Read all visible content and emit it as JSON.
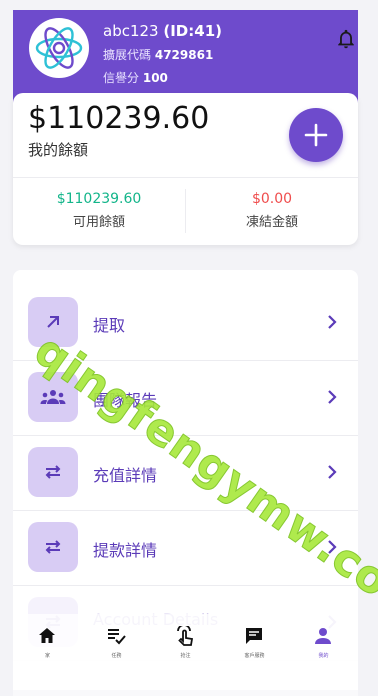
{
  "header": {
    "username": "abc123",
    "user_id": "(ID:41)",
    "promo_label": "擴展代碼",
    "promo_code": "4729861",
    "credit_label": "信譽分",
    "credit_value": "100",
    "accent": "#6e4bcc"
  },
  "balance_card": {
    "amount": "$110239.60",
    "label": "我的餘額",
    "available_value": "$110239.60",
    "available_label": "可用餘額",
    "frozen_value": "$0.00",
    "frozen_label": "凍結金額",
    "available_color": "#13b58a",
    "frozen_color": "#ef4d4d"
  },
  "menu": {
    "items": [
      {
        "label": "提取",
        "icon": "arrow-up-right-icon"
      },
      {
        "label": "團隊報告",
        "icon": "group-icon"
      },
      {
        "label": "充值詳情",
        "icon": "swap-icon"
      },
      {
        "label": "提款詳情",
        "icon": "swap-icon"
      },
      {
        "label": "Account Details",
        "icon": "swap-icon"
      }
    ]
  },
  "tabbar": {
    "tabs": [
      {
        "label": "家",
        "icon": "home-icon"
      },
      {
        "label": "任務",
        "icon": "task-list-icon"
      },
      {
        "label": "抢注",
        "icon": "touch-icon"
      },
      {
        "label": "客戶服務",
        "icon": "chat-icon"
      },
      {
        "label": "我的",
        "icon": "person-icon"
      }
    ]
  },
  "watermark": "qingfengymw.com"
}
